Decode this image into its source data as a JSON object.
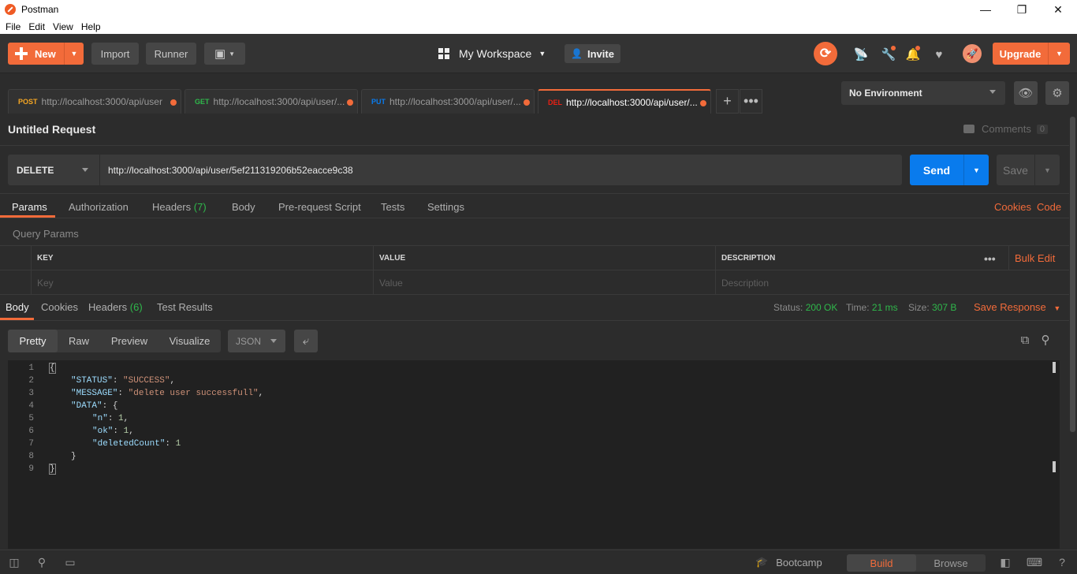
{
  "window": {
    "title": "Postman",
    "controls": {
      "minimize": "—",
      "maximize": "❐",
      "close": "✕"
    }
  },
  "menu": [
    "File",
    "Edit",
    "View",
    "Help"
  ],
  "header": {
    "new_label": "New",
    "import_label": "Import",
    "runner_label": "Runner",
    "workspace_label": "My Workspace",
    "invite_label": "Invite",
    "upgrade_label": "Upgrade"
  },
  "request_tabs": [
    {
      "method": "POST",
      "method_color": "#f5a623",
      "url": "http://localhost:3000/api/user",
      "active": false
    },
    {
      "method": "GET",
      "method_color": "#2fb84b",
      "url": "http://localhost:3000/api/user/...",
      "active": false
    },
    {
      "method": "PUT",
      "method_color": "#097bed",
      "url": "http://localhost:3000/api/user/...",
      "active": false
    },
    {
      "method": "DEL",
      "method_color": "#eb2013",
      "url": "http://localhost:3000/api/user/...",
      "active": true
    }
  ],
  "environment": {
    "selected": "No Environment"
  },
  "request": {
    "title": "Untitled Request",
    "comments_label": "Comments",
    "comments_count": "0",
    "method": "DELETE",
    "url": "http://localhost:3000/api/user/5ef211319206b52eacce9c38",
    "send_label": "Send",
    "save_label": "Save"
  },
  "request_subtabs": {
    "params": "Params",
    "authorization": "Authorization",
    "headers": "Headers",
    "headers_count": "(7)",
    "body": "Body",
    "prerequest": "Pre-request Script",
    "tests": "Tests",
    "settings": "Settings",
    "cookies_link": "Cookies",
    "code_link": "Code"
  },
  "query_params": {
    "label": "Query Params",
    "columns": {
      "key": "KEY",
      "value": "VALUE",
      "description": "DESCRIPTION"
    },
    "bulk_edit": "Bulk Edit",
    "placeholders": {
      "key": "Key",
      "value": "Value",
      "description": "Description"
    }
  },
  "response": {
    "tabs": {
      "body": "Body",
      "cookies": "Cookies",
      "headers": "Headers",
      "headers_count": "(6)",
      "test_results": "Test Results"
    },
    "status_label": "Status:",
    "status_value": "200 OK",
    "time_label": "Time:",
    "time_value": "21 ms",
    "size_label": "Size:",
    "size_value": "307 B",
    "save_response": "Save Response",
    "view_modes": [
      "Pretty",
      "Raw",
      "Preview",
      "Visualize"
    ],
    "active_view": "Pretty",
    "format": "JSON",
    "lines": [
      {
        "num": "1",
        "indent": 0,
        "key": "",
        "value": "",
        "value_type": "",
        "suffix": "{"
      },
      {
        "num": "2",
        "indent": 1,
        "key": "\"STATUS\"",
        "value": "\"SUCCESS\"",
        "value_type": "str",
        "suffix": ","
      },
      {
        "num": "3",
        "indent": 1,
        "key": "\"MESSAGE\"",
        "value": "\"delete user successfull\"",
        "value_type": "str",
        "suffix": ","
      },
      {
        "num": "4",
        "indent": 1,
        "key": "\"DATA\"",
        "value": "",
        "value_type": "",
        "suffix": "{"
      },
      {
        "num": "5",
        "indent": 2,
        "key": "\"n\"",
        "value": "1",
        "value_type": "num",
        "suffix": ","
      },
      {
        "num": "6",
        "indent": 2,
        "key": "\"ok\"",
        "value": "1",
        "value_type": "num",
        "suffix": ","
      },
      {
        "num": "7",
        "indent": 2,
        "key": "\"deletedCount\"",
        "value": "1",
        "value_type": "num",
        "suffix": ""
      },
      {
        "num": "8",
        "indent": 1,
        "key": "",
        "value": "",
        "value_type": "",
        "suffix": "}"
      },
      {
        "num": "9",
        "indent": 0,
        "key": "",
        "value": "",
        "value_type": "",
        "suffix": "}"
      }
    ]
  },
  "statusbar": {
    "bootcamp_label": "Bootcamp",
    "build_label": "Build",
    "browse_label": "Browse"
  },
  "colors": {
    "accent": "#f26b3a",
    "send_blue": "#097bed",
    "success_green": "#2fb84b"
  }
}
